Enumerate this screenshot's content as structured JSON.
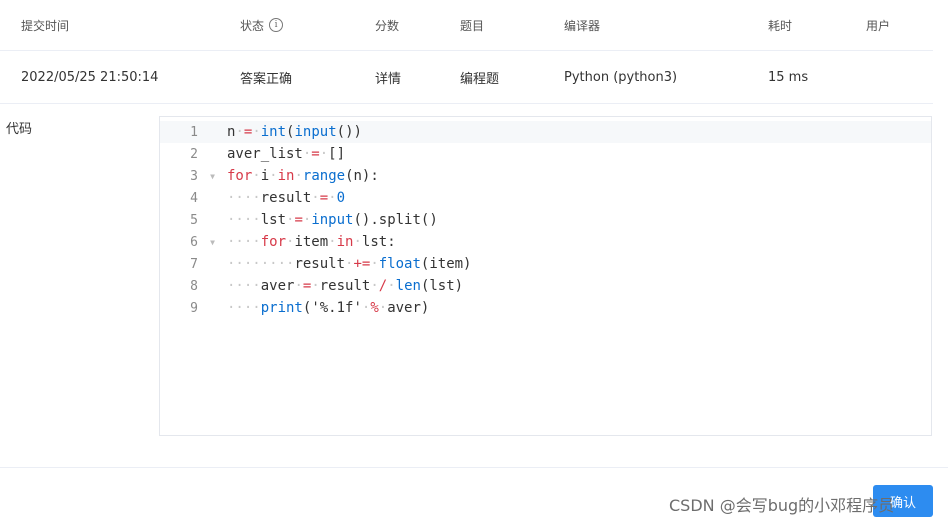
{
  "table": {
    "headers": {
      "submit_time": "提交时间",
      "status": "状态",
      "score": "分数",
      "problem": "题目",
      "compiler": "编译器",
      "duration": "耗时",
      "user": "用户"
    },
    "row": {
      "submit_time": "2022/05/25 21:50:14",
      "status": "答案正确",
      "score": "详情",
      "problem": "编程题",
      "compiler": "Python (python3)",
      "duration": "15 ms",
      "user": ""
    }
  },
  "code_label": "代码",
  "code": {
    "language": "python3",
    "lines": [
      "n = int(input())",
      "aver_list = []",
      "for i in range(n):",
      "    result = 0",
      "    lst = input().split()",
      "    for item in lst:",
      "        result += float(item)",
      "    aver = result / len(lst)",
      "    print('%.1f' % aver)"
    ],
    "line_numbers": [
      "1",
      "2",
      "3",
      "4",
      "5",
      "6",
      "7",
      "8",
      "9"
    ],
    "fold_markers": {
      "3": "▼",
      "6": "▼"
    }
  },
  "footer": {
    "watermark": "CSDN @会写bug的小邓程序员",
    "button_label": "确认"
  },
  "colors": {
    "status_ok": "#e64a4a",
    "keyword": "#d73a49",
    "builtin": "#0a6ecf",
    "primary_button": "#2d8cf0"
  }
}
